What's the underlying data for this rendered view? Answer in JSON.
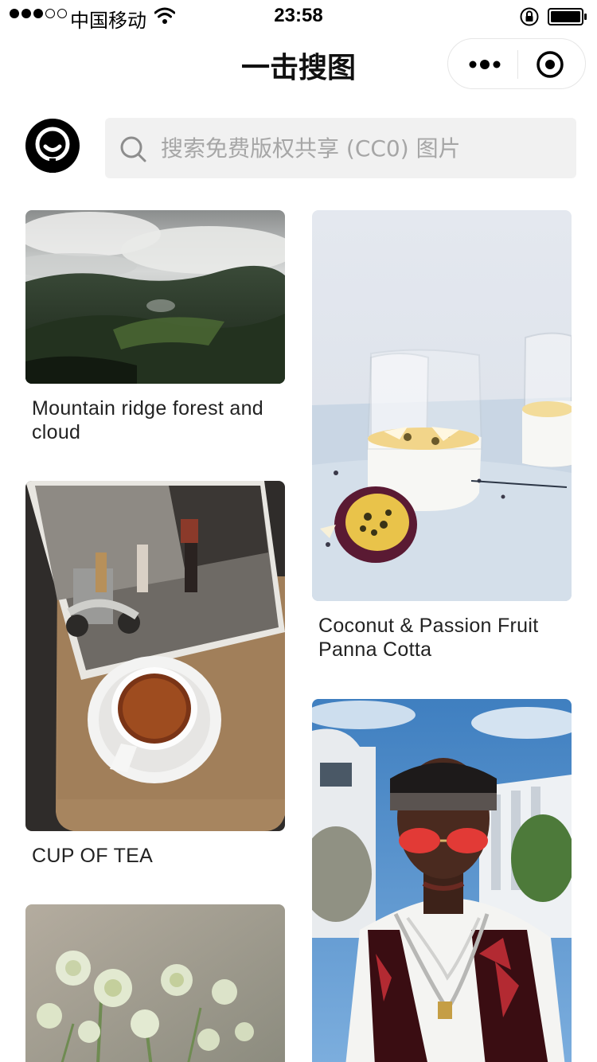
{
  "status_bar": {
    "carrier": "中国移动",
    "time": "23:58"
  },
  "nav": {
    "title": "一击搜图"
  },
  "search": {
    "placeholder": "搜索免费版权共享 (CC0) 图片",
    "value": ""
  },
  "cards": [
    {
      "title": "Mountain ridge forest and cloud"
    },
    {
      "title": "Coconut & Passion Fruit Panna Cotta"
    },
    {
      "title": "CUP OF TEA"
    },
    {
      "title": ""
    },
    {
      "title": ""
    }
  ],
  "colors": {
    "background": "#ffffff",
    "search_bg": "#f1f1f1",
    "text": "#222222",
    "placeholder": "#a6a6a6"
  }
}
